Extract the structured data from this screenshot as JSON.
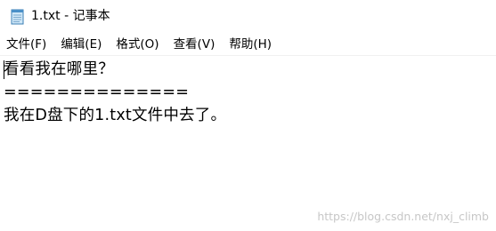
{
  "window": {
    "title": "1.txt - 记事本",
    "icon": "notepad-icon"
  },
  "menu": {
    "items": [
      {
        "label": "文件(F)"
      },
      {
        "label": "编辑(E)"
      },
      {
        "label": "格式(O)"
      },
      {
        "label": "查看(V)"
      },
      {
        "label": "帮助(H)"
      }
    ]
  },
  "editor": {
    "lines": [
      "看看我在哪里？",
      "==============",
      "我在D盘下的1.txt文件中去了。"
    ]
  },
  "watermark": {
    "text": "https://blog.csdn.net/nxj_climb"
  }
}
